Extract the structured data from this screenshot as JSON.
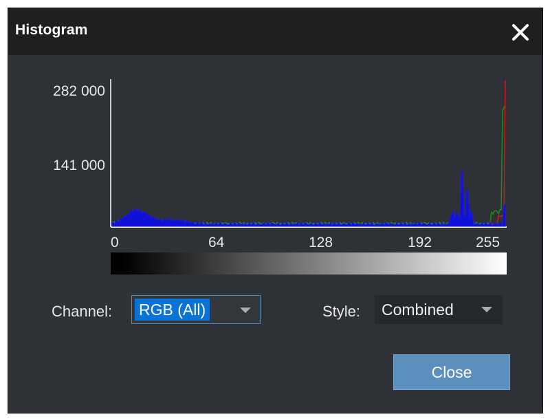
{
  "dialog": {
    "title": "Histogram",
    "close_icon": "close-icon"
  },
  "histogram": {
    "y_tick_top": "282 000",
    "y_tick_mid": "141 000",
    "x_ticks": [
      "0",
      "64",
      "128",
      "192",
      "255"
    ]
  },
  "controls": {
    "channel_label": "Channel:",
    "channel_value": "RGB (All)",
    "style_label": "Style:",
    "style_value": "Combined"
  },
  "footer": {
    "close_label": "Close"
  },
  "colors": {
    "background": "#2e3236",
    "titlebar": "#1d1f21",
    "accent": "#5b8fbe",
    "selection": "#0a73d8",
    "red": "#d01818",
    "green": "#1f8a1f",
    "blue": "#1010d8"
  }
}
